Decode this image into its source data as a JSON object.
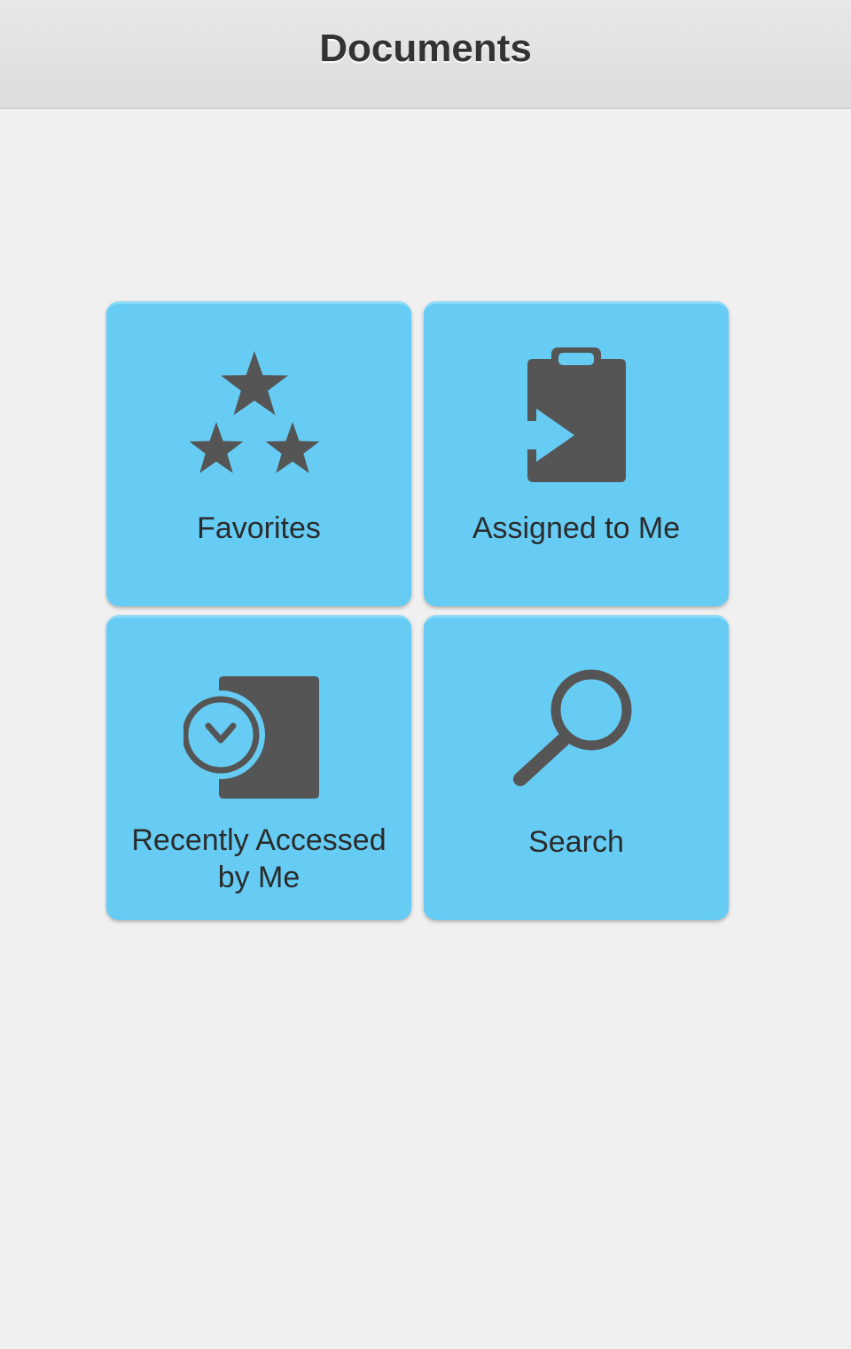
{
  "header": {
    "title": "Documents"
  },
  "tiles": [
    {
      "label": "Favorites",
      "icon": "stars-icon"
    },
    {
      "label": "Assigned to Me",
      "icon": "clipboard-assign-icon"
    },
    {
      "label_line1": "Recently Accessed",
      "label_line2": "by Me",
      "icon": "recent-document-clock-icon"
    },
    {
      "label": "Search",
      "icon": "magnifier-icon"
    }
  ],
  "colors": {
    "tile_background": "#66ccf4",
    "icon": "#555555",
    "page_background": "#f0f0f0",
    "header_background": "#dcdcdc",
    "text": "#2b2b2b"
  }
}
